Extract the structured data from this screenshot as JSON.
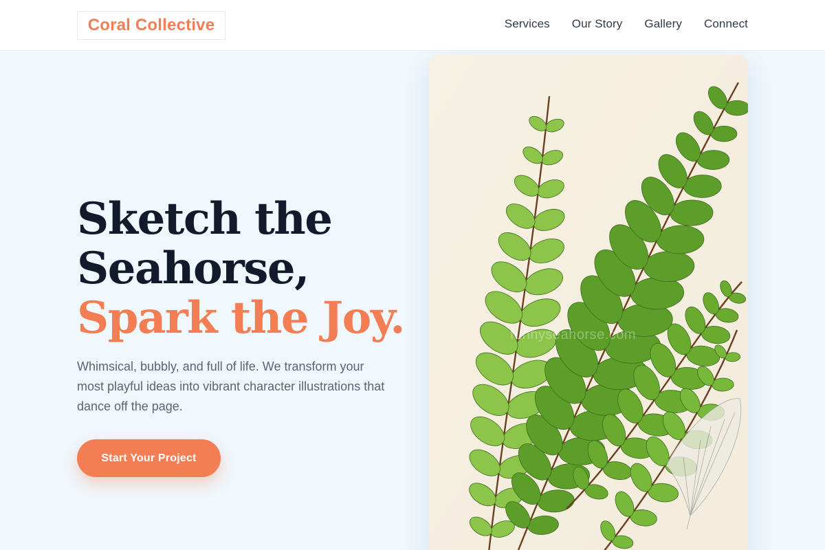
{
  "header": {
    "logo": "Coral Collective",
    "nav": [
      "Services",
      "Our Story",
      "Gallery",
      "Connect"
    ]
  },
  "hero": {
    "headline_lines": [
      "Sketch the",
      "Seahorse,",
      "Spark the Joy."
    ],
    "subtext": "Whimsical, bubbly, and full of life. We transform your most playful ideas into vibrant character illustrations that dance off the page.",
    "cta": "Start Your Project",
    "image_watermark": "funnyseahorse.com"
  },
  "colors": {
    "accent": "#f37e54",
    "headline_dark": "#121a2c",
    "page_background": "#f0f7fd",
    "header_background": "#ffffff",
    "image_background": "#f8f2e4"
  },
  "icons": {
    "hero_image": "fern-illustration"
  }
}
